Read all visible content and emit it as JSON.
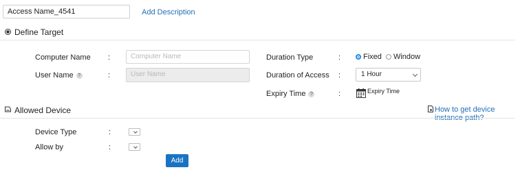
{
  "header": {
    "access_name_value": "Access Name_4541",
    "add_description": "Add Description"
  },
  "define_target": {
    "title": "Define Target",
    "computer_name_label": "Computer Name",
    "computer_name_placeholder": "Computer Name",
    "user_name_label": "User Name",
    "user_name_placeholder": "User Name",
    "colon": ":",
    "help_glyph": "?"
  },
  "duration": {
    "type_label": "Duration Type",
    "options": [
      "Fixed",
      "Window"
    ],
    "selected": "Fixed",
    "access_label": "Duration of Access",
    "access_value": "1 Hour",
    "expiry_label": "Expiry Time",
    "expiry_value": "Expiry Time"
  },
  "allowed_device": {
    "title": "Allowed Device",
    "help_link": "How to get device instance path?",
    "device_type_label": "Device Type",
    "allow_by_label": "Allow by",
    "add_button": "Add"
  },
  "colors": {
    "accent": "#1a73c2",
    "link": "#1f6fb5"
  }
}
